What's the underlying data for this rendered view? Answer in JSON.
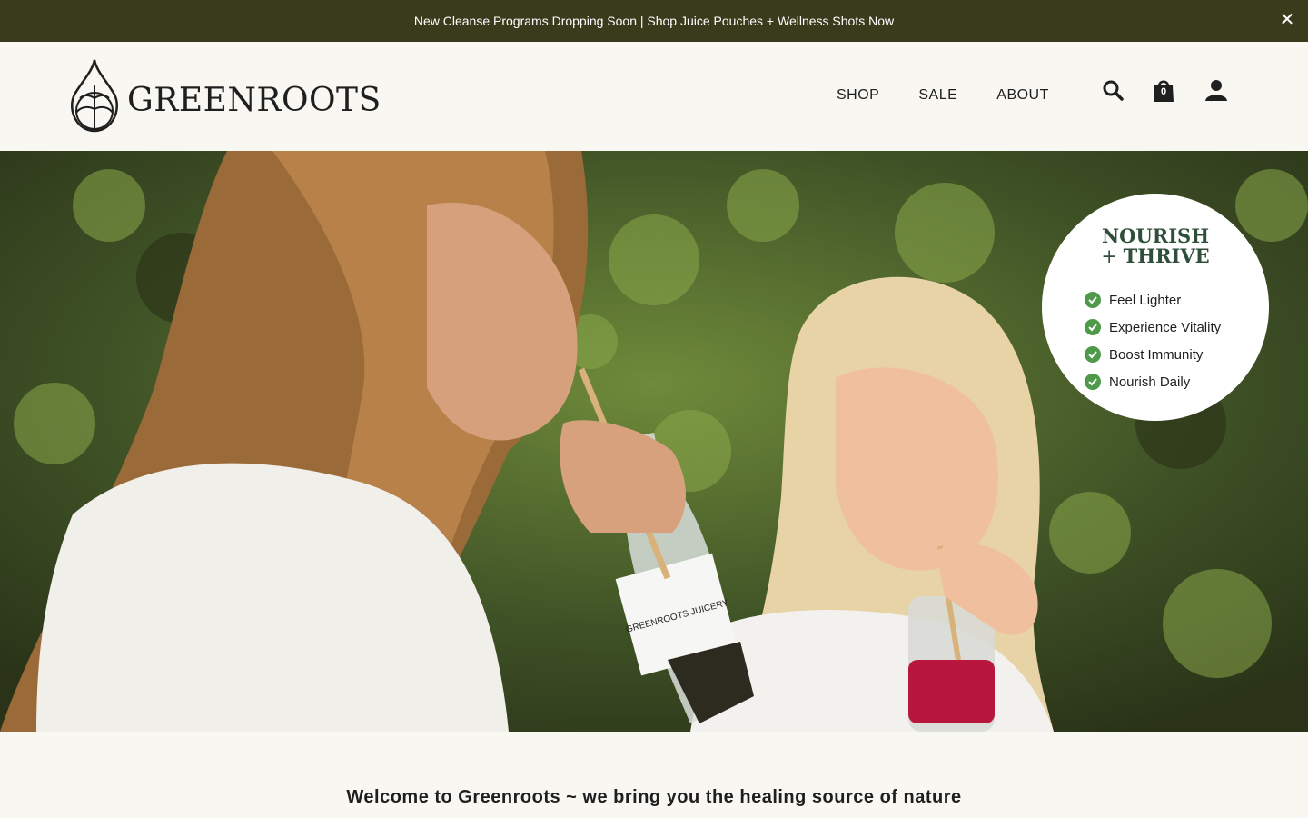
{
  "announcement": {
    "text": "New Cleanse Programs Dropping Soon | Shop Juice Pouches + Wellness Shots Now",
    "close_label": "✕"
  },
  "header": {
    "logo_text": "GREENROOTS",
    "nav": [
      {
        "label": "SHOP"
      },
      {
        "label": "SALE"
      },
      {
        "label": "ABOUT"
      }
    ],
    "cart_count": "0",
    "icons": [
      "search-icon",
      "cart-icon",
      "account-icon"
    ]
  },
  "hero": {
    "badge": {
      "title_line1": "NOURISH",
      "title_plus": "+ ",
      "title_line2": "THRIVE",
      "items": [
        {
          "label": "Feel Lighter"
        },
        {
          "label": "Experience Vitality"
        },
        {
          "label": "Boost Immunity"
        },
        {
          "label": "Nourish Daily"
        }
      ]
    },
    "bottle_label": "GREENROOTS JUICERY"
  },
  "welcome": {
    "text": "Welcome to Greenroots ~ we bring you the healing source of nature"
  },
  "colors": {
    "announcement_bg": "#3a3b1d",
    "page_bg": "#f8f7f1",
    "badge_title": "#2f4f3a",
    "check": "#4f9a4a"
  }
}
